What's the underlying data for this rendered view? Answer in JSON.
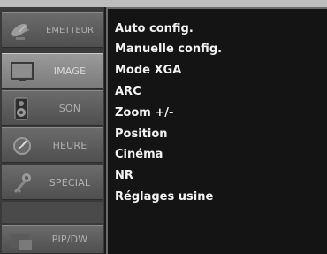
{
  "tabs": [
    {
      "label": "EMETTEUR",
      "icon": "satellite-dish-icon",
      "active": false
    },
    {
      "label": "IMAGE",
      "icon": "monitor-icon",
      "active": true
    },
    {
      "label": "SON",
      "icon": "speaker-icon",
      "active": false
    },
    {
      "label": "HEURE",
      "icon": "clock-icon",
      "active": false
    },
    {
      "label": "SPÉCIAL",
      "icon": "key-icon",
      "active": false
    },
    {
      "label": "PIP/DW",
      "icon": "pip-icon",
      "active": false
    }
  ],
  "menu": {
    "items": [
      {
        "label": "Auto config."
      },
      {
        "label": "Manuelle config."
      },
      {
        "label": "Mode XGA"
      },
      {
        "label": "ARC"
      },
      {
        "label": "Zoom +/-"
      },
      {
        "label": "Position"
      },
      {
        "label": "Cinéma"
      },
      {
        "label": "NR"
      },
      {
        "label": "Réglages usine"
      }
    ]
  }
}
